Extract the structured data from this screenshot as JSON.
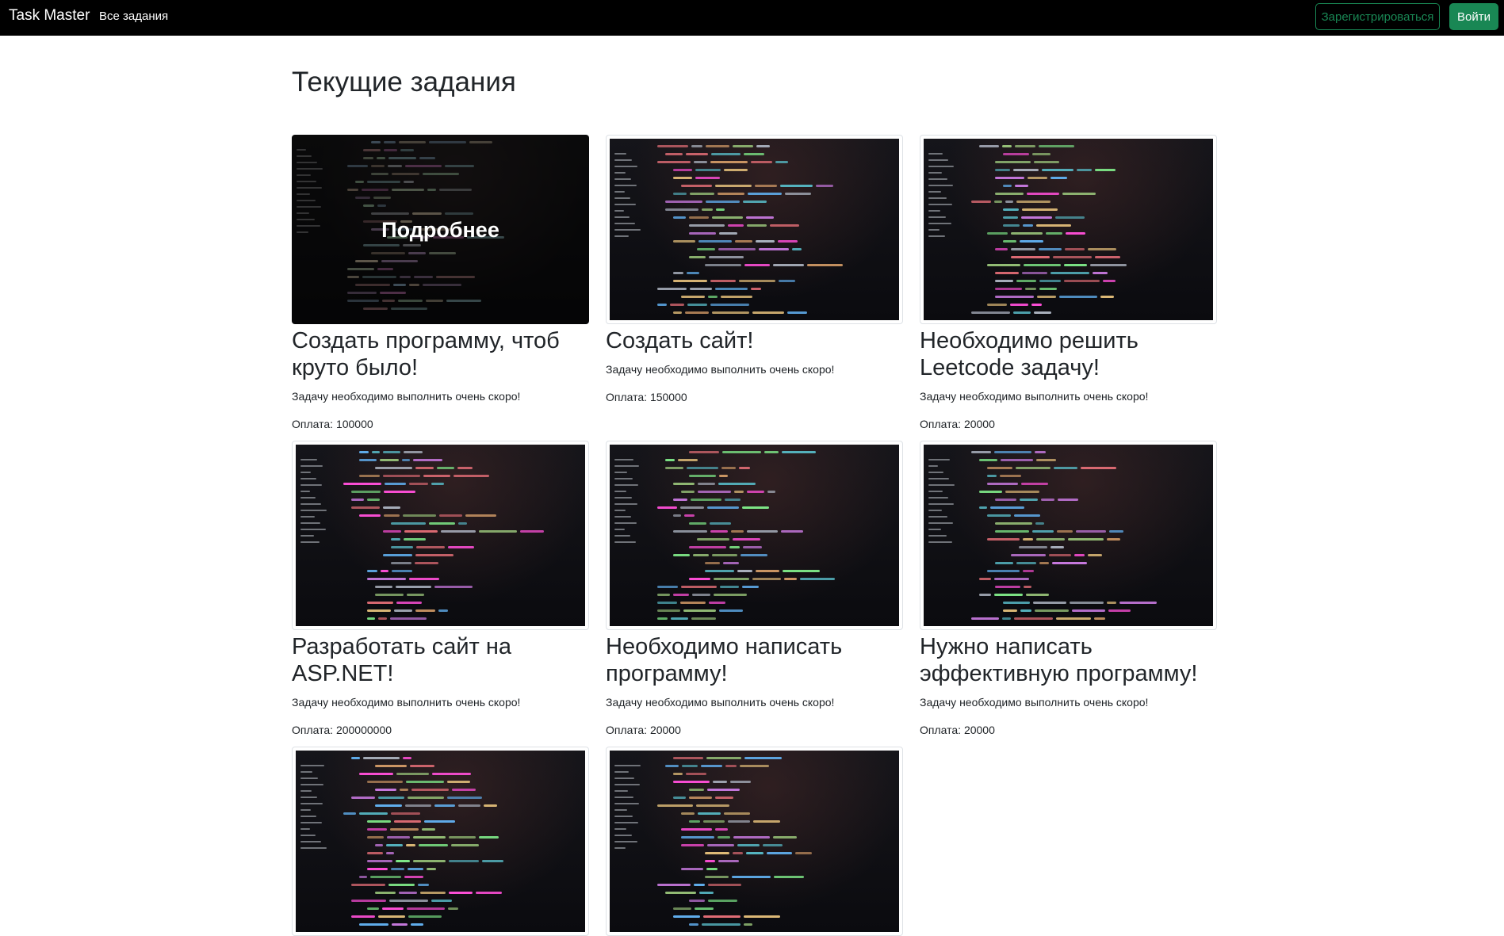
{
  "nav": {
    "brand": "Task Master",
    "all_tasks": "Все задания",
    "register": "Зарегистрироваться",
    "login": "Войти"
  },
  "page": {
    "title": "Текущие задания"
  },
  "colors": {
    "accent": "#198754",
    "navbar": "#000000"
  },
  "cards": [
    {
      "title": "Создать программу, чтоб круто было!",
      "desc": "Задачу необходимо выполнить очень скоро!",
      "pay": "Оплата: 100000",
      "overlay": "Подробнее"
    },
    {
      "title": "Создать сайт!",
      "desc": "Задачу необходимо выполнить очень скоро!",
      "pay": "Оплата: 150000"
    },
    {
      "title": "Необходимо решить Leetcode задачу!",
      "desc": "Задачу необходимо выполнить очень скоро!",
      "pay": "Оплата: 20000"
    },
    {
      "title": "Разработать сайт на ASP.NET!",
      "desc": "Задачу необходимо выполнить очень скоро!",
      "pay": "Оплата: 200000000"
    },
    {
      "title": "Необходимо написать программу!",
      "desc": "Задачу необходимо выполнить очень скоро!",
      "pay": "Оплата: 20000"
    },
    {
      "title": "Нужно написать эффективную программу!",
      "desc": "Задачу необходимо выполнить очень скоро!",
      "pay": "Оплата: 20000"
    }
  ]
}
